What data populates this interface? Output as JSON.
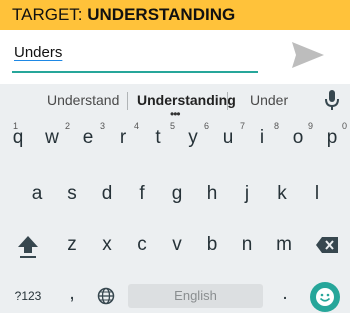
{
  "banner": {
    "prefix": "TARGET: ",
    "word": "UNDERSTANDING",
    "color": "#ffc23a"
  },
  "input": {
    "value": "Unders",
    "underline_color": "#26a69a"
  },
  "icons": {
    "send": "send-icon",
    "mic": "mic-icon",
    "shift": "shift-icon",
    "backspace": "backspace-icon",
    "globe": "globe-icon",
    "emoji": "emoji-icon"
  },
  "suggestions": [
    "Understand",
    "Understanding",
    "Under"
  ],
  "more": "•••",
  "rows": {
    "row1": [
      "q",
      "w",
      "e",
      "r",
      "t",
      "y",
      "u",
      "i",
      "o",
      "p"
    ],
    "row1_hints": [
      "1",
      "2",
      "3",
      "4",
      "5",
      "6",
      "7",
      "8",
      "9",
      "0"
    ],
    "row2": [
      "a",
      "s",
      "d",
      "f",
      "g",
      "h",
      "j",
      "k",
      "l"
    ],
    "row3": [
      "z",
      "x",
      "c",
      "v",
      "b",
      "n",
      "m"
    ]
  },
  "bottom": {
    "symbols": "?123",
    "comma": ",",
    "space": "English",
    "period": "."
  },
  "accent_color": "#26a69a"
}
